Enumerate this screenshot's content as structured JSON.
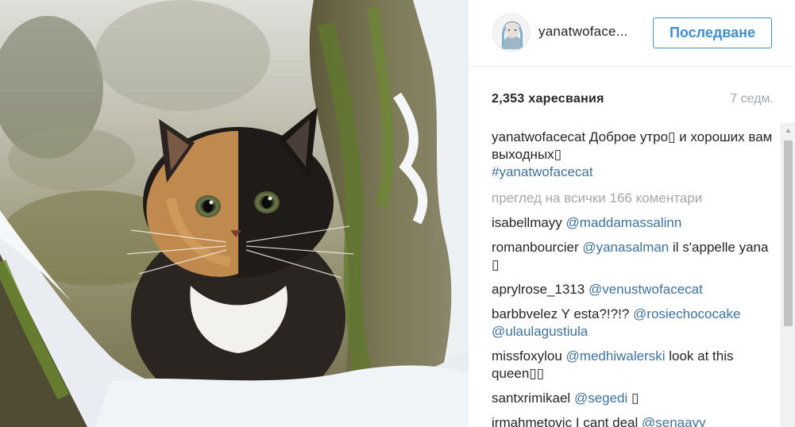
{
  "post": {
    "photo_subject": "cat-photo"
  },
  "header": {
    "username": "yanatwoface...",
    "follow_label": "Последване"
  },
  "stats": {
    "likes": "2,353 харесвания",
    "time": "7 седм."
  },
  "caption": {
    "user": "yanatwofacecat",
    "text": "Доброе утро▯ и хороших вам выходных▯",
    "hashtag": "#yanatwofacecat"
  },
  "view_all": "преглед на всички 166 коментари",
  "comments": [
    {
      "user": "isabellmayy",
      "mention": "@maddamassalinn",
      "text": ""
    },
    {
      "user": "romanbourcier",
      "mention": "@yanasalman",
      "text": "il s'appelle yana ▯"
    },
    {
      "user": "aprylrose_1313",
      "mention": "@venustwofacecat",
      "text": ""
    },
    {
      "user": "barbbvelez",
      "pre": "Y esta?!?!?",
      "mention": "@rosiechococake",
      "mention2": "@ulaulagustiula",
      "text": ""
    },
    {
      "user": "missfoxylou",
      "mention": "@medhiwalerski",
      "text": "look at this queen▯▯"
    },
    {
      "user": "santxrimikael",
      "mention": "@segedi",
      "text": "▯"
    },
    {
      "user": "irmahmetovic",
      "pre": "I cant deal",
      "mention": "@senaayy_",
      "text": ""
    }
  ]
}
